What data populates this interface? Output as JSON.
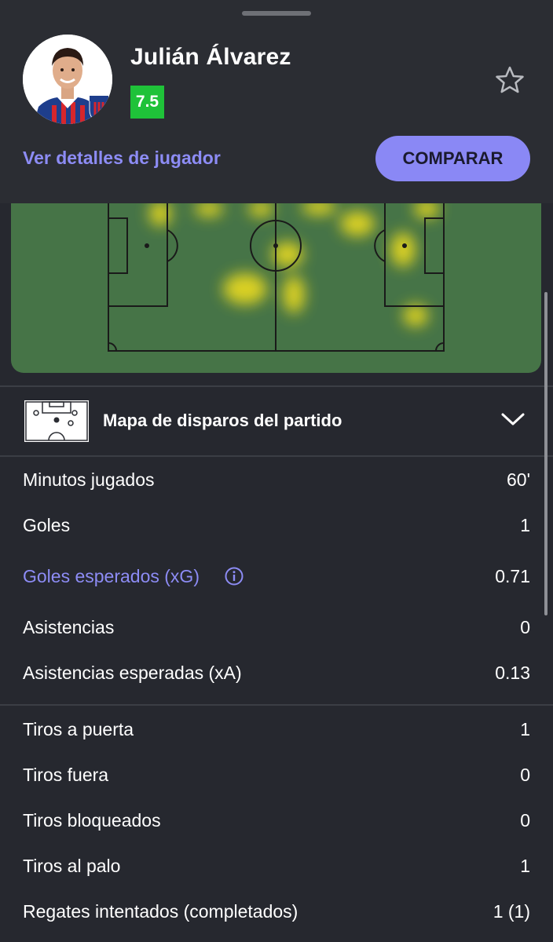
{
  "player": {
    "name": "Julián Álvarez",
    "rating": "7.5"
  },
  "actions": {
    "details_link": "Ver detalles de jugador",
    "compare_label": "COMPARAR"
  },
  "shot_map": {
    "title": "Mapa de disparos del partido"
  },
  "stats_group1": [
    {
      "label": "Minutos jugados",
      "value": "60'"
    },
    {
      "label": "Goles",
      "value": "1"
    },
    {
      "label": "Goles esperados (xG)",
      "value": "0.71"
    },
    {
      "label": "Asistencias",
      "value": "0"
    },
    {
      "label": "Asistencias esperadas (xA)",
      "value": "0.13"
    }
  ],
  "stats_group2": [
    {
      "label": "Tiros a puerta",
      "value": "1"
    },
    {
      "label": "Tiros fuera",
      "value": "0"
    },
    {
      "label": "Tiros bloqueados",
      "value": "0"
    },
    {
      "label": "Tiros al palo",
      "value": "1"
    },
    {
      "label": "Regates intentados (completados)",
      "value": "1 (1)"
    }
  ],
  "colors": {
    "background": "#26282f",
    "accent": "#8a88f5",
    "rating_green": "#1fc239",
    "pitch_green": "#467447",
    "heat_yellow": "#f4e11c"
  }
}
